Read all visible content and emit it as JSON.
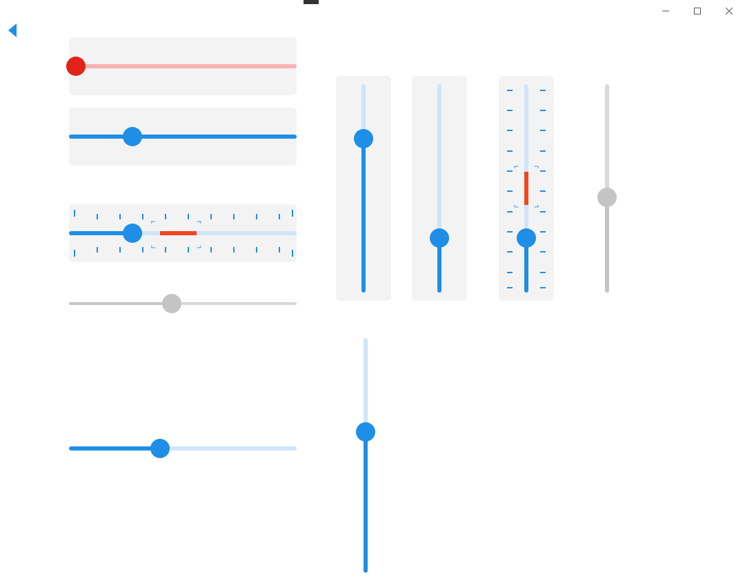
{
  "window": {
    "minimize_icon": "minimize-icon",
    "maximize_icon": "maximize-icon",
    "close_icon": "close-icon"
  },
  "back_icon": "back-icon",
  "horiz_sliders": [
    {
      "id": "red",
      "card": true,
      "value_pct": 3,
      "thumb_color": "red",
      "fill": "red"
    },
    {
      "id": "blue1",
      "card": true,
      "value_pct": 28,
      "thumb_color": "blue",
      "fill": "blue"
    },
    {
      "id": "range",
      "card": true,
      "value_pct": 28,
      "range_start_pct": 40,
      "range_end_pct": 56,
      "ticks": true
    },
    {
      "id": "disabled",
      "card": false,
      "value_pct": 45,
      "thumb_color": "gray",
      "fill": "gray"
    },
    {
      "id": "blue2",
      "card": false,
      "value_pct": 40,
      "thumb_color": "blue",
      "fill": "blue"
    }
  ],
  "vert_sliders_top": [
    {
      "id": "v1",
      "card": true,
      "value_pct": 72
    },
    {
      "id": "v2",
      "card": true,
      "value_pct": 28
    },
    {
      "id": "v3",
      "card": true,
      "value_pct": 28,
      "range_start_pct": 42,
      "range_end_pct": 58,
      "ticks": true
    },
    {
      "id": "v4",
      "card": false,
      "value_pct": 46,
      "color": "gray"
    }
  ],
  "vert_slider_bottom": {
    "id": "v5",
    "value_pct": 60
  },
  "colors": {
    "accent": "#1e8ee7",
    "accent_light": "#cfe4f8",
    "orange": "#ef471f",
    "red": "#e2231a",
    "gray": "#c4c4c4",
    "card_bg": "#f3f3f3"
  }
}
